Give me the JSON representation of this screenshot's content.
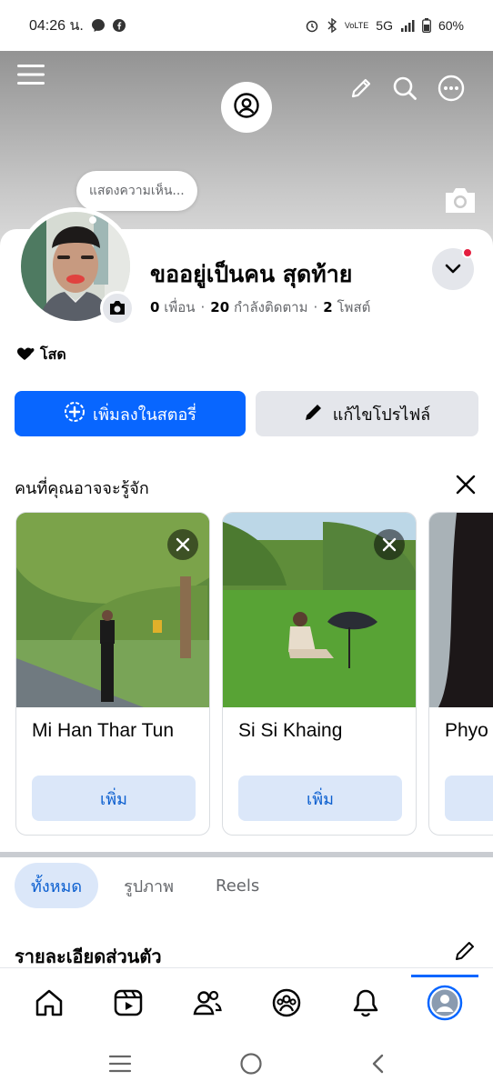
{
  "status_bar": {
    "time": "04:26 น.",
    "network": "5G",
    "volte": "VoLTE",
    "battery": "60%"
  },
  "header": {
    "menu_icon": "hamburger-icon",
    "edit_icon": "pencil-icon",
    "search_icon": "search-icon",
    "more_icon": "more-icon"
  },
  "profile": {
    "thought_placeholder": "แสดงความเห็น...",
    "name": "ขออยู่เป็นคน สุดท้าย",
    "friends_count": "0",
    "friends_label": "เพื่อน",
    "following_count": "20",
    "following_label": "กำลังติดตาม",
    "posts_count": "2",
    "posts_label": "โพสต์",
    "relationship": "โสด"
  },
  "actions": {
    "add_story": "เพิ่มลงในสตอรี่",
    "edit_profile": "แก้ไขโปรไฟล์"
  },
  "people_you_may_know": {
    "title": "คนที่คุณอาจจะรู้จัก",
    "people": [
      {
        "name": "Mi Han Thar Tun",
        "action": "เพิ่ม"
      },
      {
        "name": "Si Si Khaing",
        "action": "เพิ่ม"
      },
      {
        "name": "Phyo",
        "action": ""
      }
    ]
  },
  "tabs": [
    {
      "label": "ทั้งหมด",
      "active": true
    },
    {
      "label": "รูปภาพ",
      "active": false
    },
    {
      "label": "Reels",
      "active": false
    }
  ],
  "section": {
    "title": "รายละเอียดส่วนตัว"
  },
  "colors": {
    "accent": "#0866ff",
    "secondary_button": "#e4e6eb",
    "add_button_bg": "#dbe7f9",
    "add_button_text": "#0a5ecf",
    "notification_dot": "#e41e3f"
  }
}
